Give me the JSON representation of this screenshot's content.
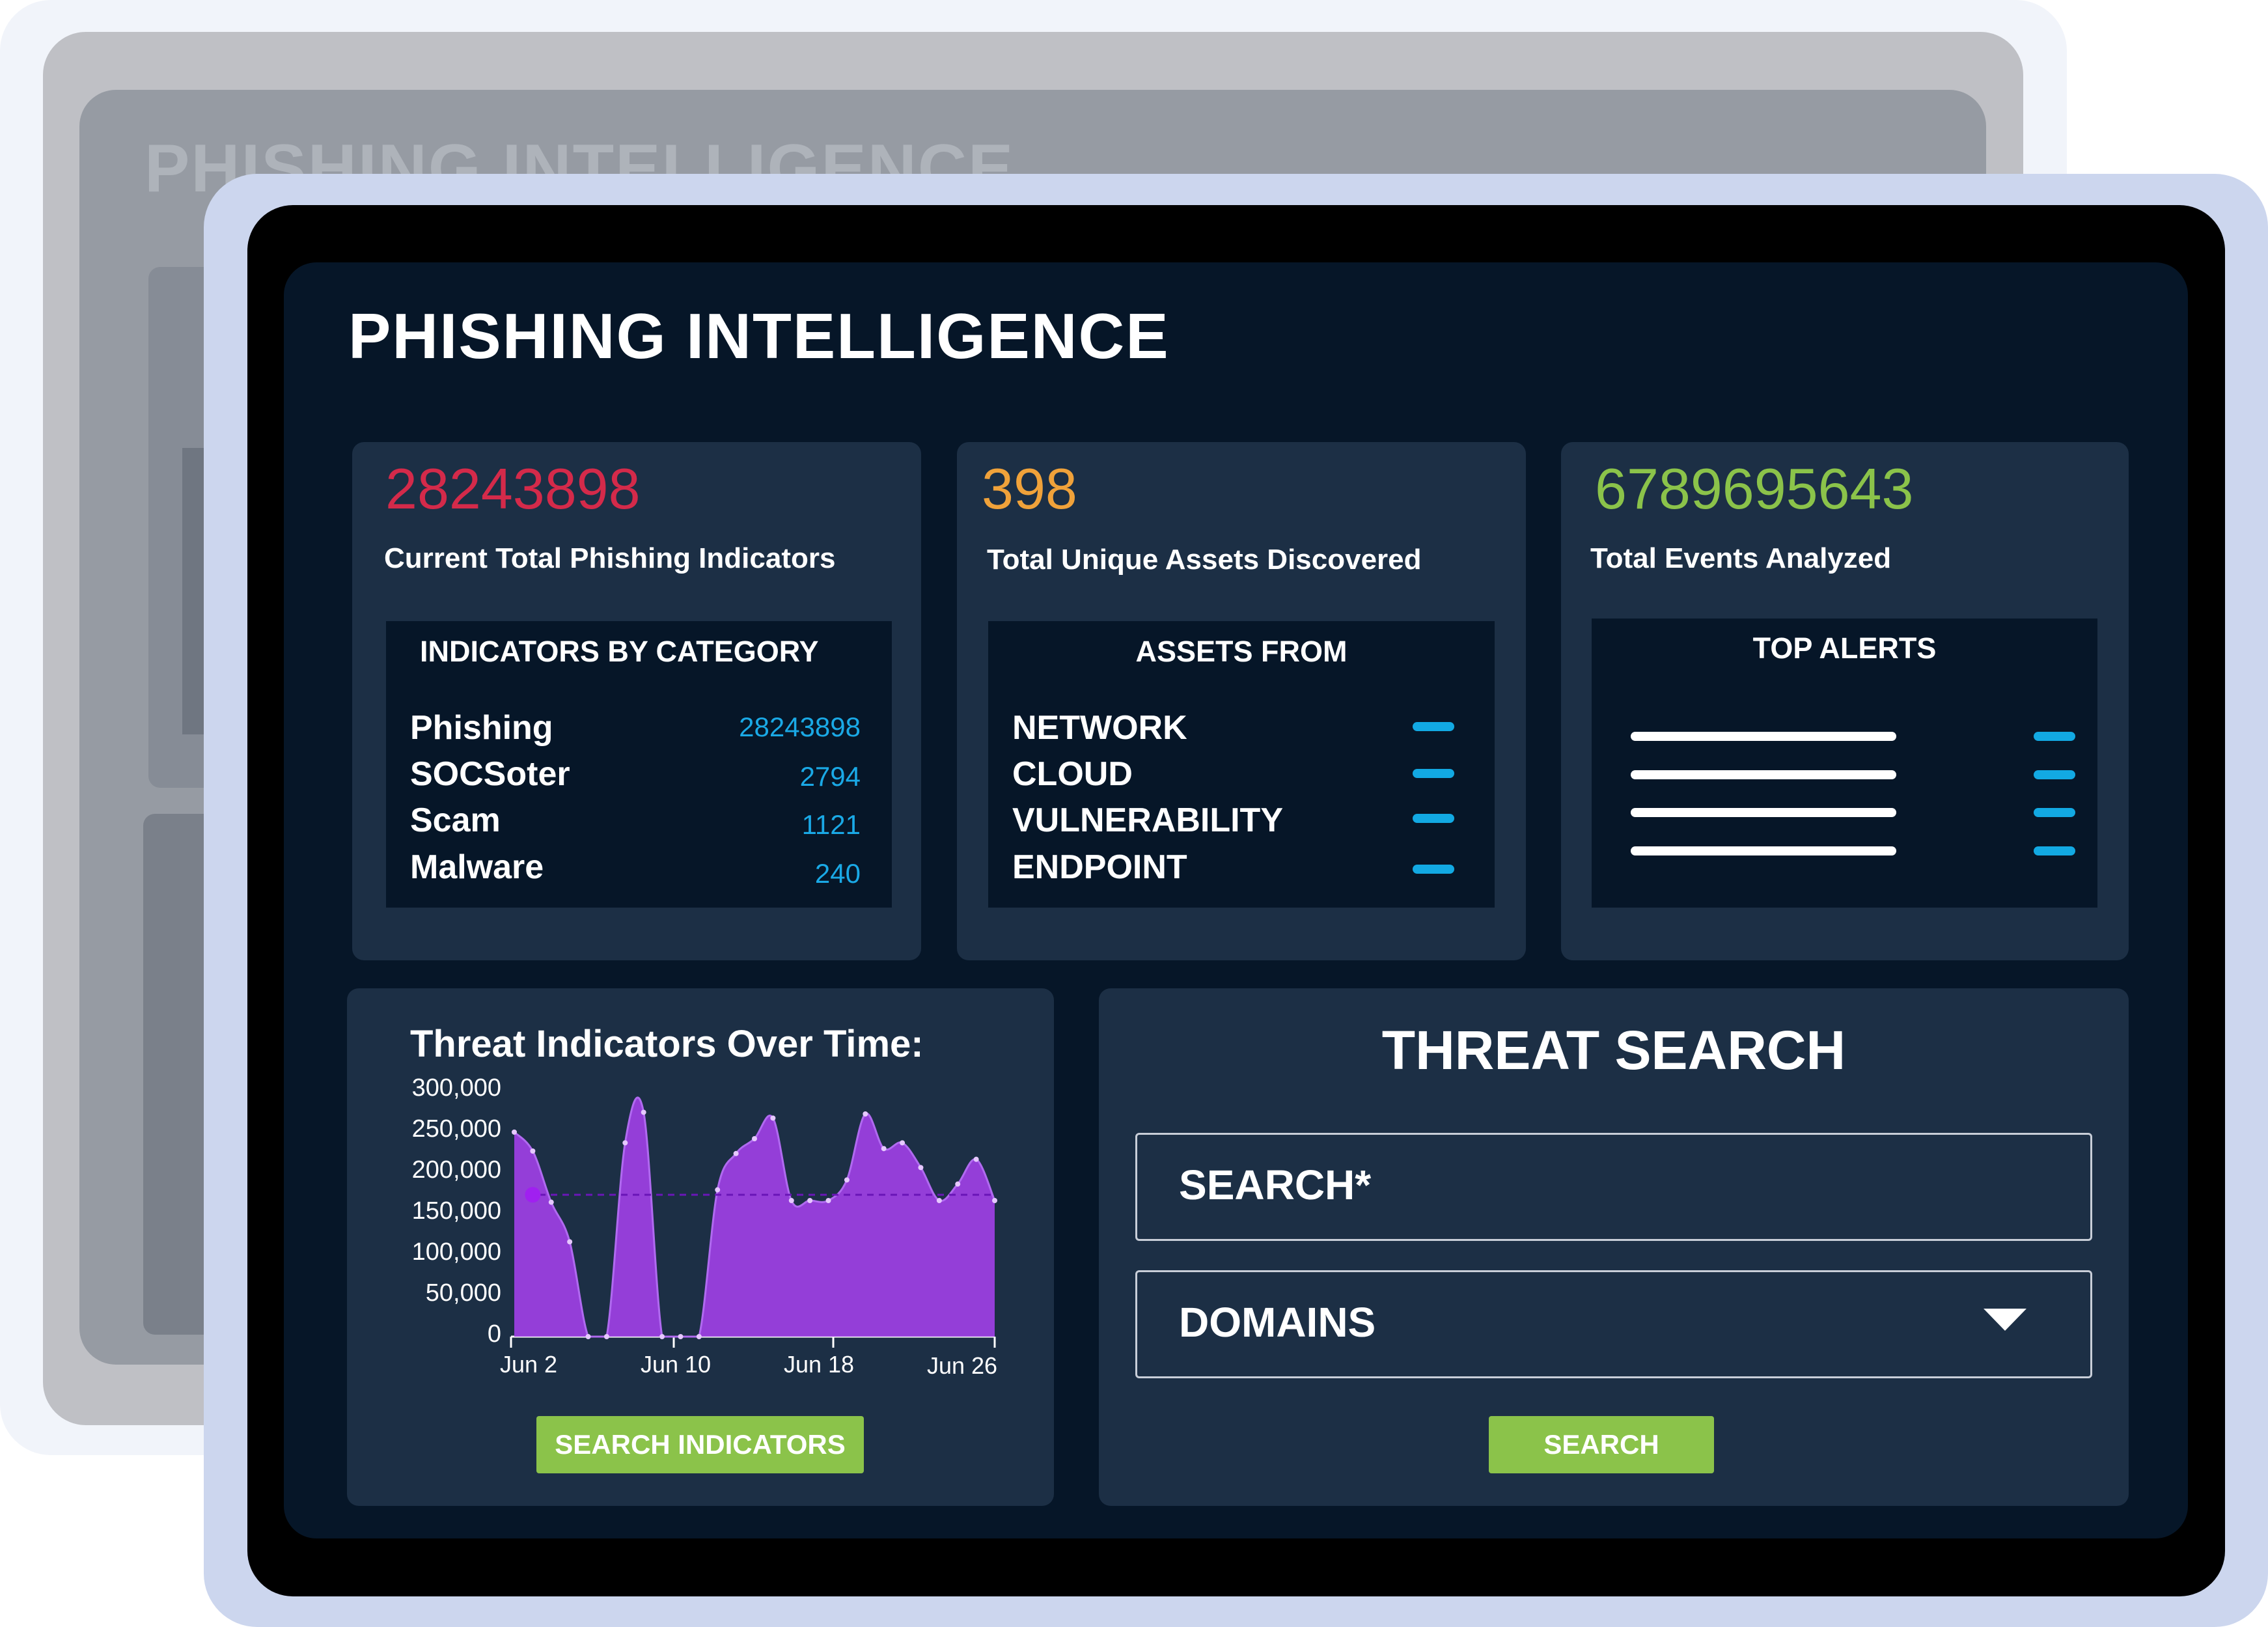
{
  "background_window": {
    "title": "PHISHING INTELLIGENCE"
  },
  "app": {
    "title": "PHISHING INTELLIGENCE"
  },
  "stats": [
    {
      "value": "28243898",
      "label": "Current Total Phishing Indicators",
      "color": "#d42a4a"
    },
    {
      "value": "398",
      "label": "Total Unique Assets Discovered",
      "color": "#f0a23a"
    },
    {
      "value": "6789695643",
      "label": "Total Events Analyzed",
      "color": "#8bc34a"
    }
  ],
  "indicators_by_category": {
    "title": "INDICATORS BY CATEGORY",
    "rows": [
      {
        "label": "Phishing",
        "value": "28243898"
      },
      {
        "label": "SOCSoter",
        "value": "2794"
      },
      {
        "label": "Scam",
        "value": "1121"
      },
      {
        "label": "Malware",
        "value": "240"
      }
    ]
  },
  "assets_from": {
    "title": "ASSETS FROM",
    "rows": [
      {
        "label": "NETWORK"
      },
      {
        "label": "CLOUD"
      },
      {
        "label": "VULNERABILITY"
      },
      {
        "label": "ENDPOINT"
      }
    ]
  },
  "top_alerts": {
    "title": "TOP ALERTS",
    "rows": 4
  },
  "chart": {
    "title": "Threat Indicators Over Time:",
    "button_label": "SEARCH INDICATORS"
  },
  "chart_data": {
    "type": "area",
    "title": "Threat Indicators Over Time:",
    "xlabel": "",
    "ylabel": "",
    "x_tick_labels": [
      "Jun 2",
      "Jun 10",
      "Jun 18",
      "Jun 26"
    ],
    "y_tick_labels": [
      "300,000",
      "250,000",
      "200,000",
      "150,000",
      "100,000",
      "50,000",
      "0"
    ],
    "ylim": [
      0,
      300000
    ],
    "x": [
      "Jun 1",
      "Jun 2",
      "Jun 3",
      "Jun 4",
      "Jun 5",
      "Jun 6",
      "Jun 7",
      "Jun 8",
      "Jun 9",
      "Jun 10",
      "Jun 11",
      "Jun 12",
      "Jun 13",
      "Jun 14",
      "Jun 15",
      "Jun 16",
      "Jun 17",
      "Jun 18",
      "Jun 19",
      "Jun 20",
      "Jun 21",
      "Jun 22",
      "Jun 23",
      "Jun 24",
      "Jun 25",
      "Jun 26",
      "Jun 27"
    ],
    "values": [
      248000,
      225000,
      163000,
      115000,
      0,
      0,
      235000,
      272000,
      0,
      0,
      0,
      178000,
      222000,
      240000,
      265000,
      165000,
      165000,
      165000,
      190000,
      270000,
      228000,
      235000,
      205000,
      165000,
      185000,
      215000,
      165000
    ],
    "average_line": 172000,
    "highlight_point": {
      "x": "Jun 2",
      "y": 172000
    },
    "series_color": "#9b3fe0",
    "grid": false
  },
  "threat_search": {
    "title": "THREAT SEARCH",
    "search_placeholder": "SEARCH*",
    "type_select": "DOMAINS",
    "button_label": "SEARCH"
  },
  "icons": {
    "dropdown": "caret-down-icon"
  }
}
